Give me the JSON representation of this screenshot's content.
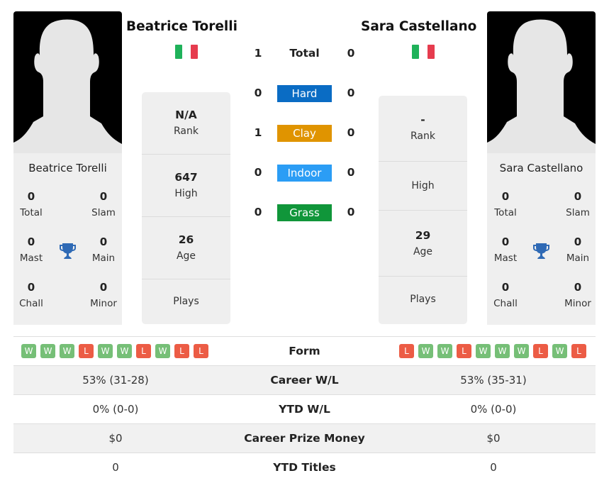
{
  "players": [
    {
      "name": "Beatrice Torelli",
      "country_flag": "italy-flag-icon",
      "titles": {
        "total": {
          "value": "0",
          "label": "Total"
        },
        "slam": {
          "value": "0",
          "label": "Slam"
        },
        "mast": {
          "value": "0",
          "label": "Mast"
        },
        "main": {
          "value": "0",
          "label": "Main"
        },
        "chall": {
          "value": "0",
          "label": "Chall"
        },
        "minor": {
          "value": "0",
          "label": "Minor"
        }
      },
      "rank": {
        "value": "N/A",
        "label": "Rank"
      },
      "high": {
        "value": "647",
        "label": "High"
      },
      "age": {
        "value": "26",
        "label": "Age"
      },
      "plays": {
        "value": "",
        "label": "Plays"
      },
      "form": [
        "W",
        "W",
        "W",
        "L",
        "W",
        "W",
        "L",
        "W",
        "L",
        "L"
      ],
      "career_wl": "53% (31-28)",
      "ytd_wl": "0% (0-0)",
      "prize_money": "$0",
      "ytd_titles": "0"
    },
    {
      "name": "Sara Castellano",
      "country_flag": "italy-flag-icon",
      "titles": {
        "total": {
          "value": "0",
          "label": "Total"
        },
        "slam": {
          "value": "0",
          "label": "Slam"
        },
        "mast": {
          "value": "0",
          "label": "Mast"
        },
        "main": {
          "value": "0",
          "label": "Main"
        },
        "chall": {
          "value": "0",
          "label": "Chall"
        },
        "minor": {
          "value": "0",
          "label": "Minor"
        }
      },
      "rank": {
        "value": "-",
        "label": "Rank"
      },
      "high": {
        "value": "",
        "label": "High"
      },
      "age": {
        "value": "29",
        "label": "Age"
      },
      "plays": {
        "value": "",
        "label": "Plays"
      },
      "form": [
        "L",
        "W",
        "W",
        "L",
        "W",
        "W",
        "W",
        "L",
        "W",
        "L"
      ],
      "career_wl": "53% (35-31)",
      "ytd_wl": "0% (0-0)",
      "prize_money": "$0",
      "ytd_titles": "0"
    }
  ],
  "h2h": [
    {
      "label": "Total",
      "left": "1",
      "right": "0",
      "color": ""
    },
    {
      "label": "Hard",
      "left": "0",
      "right": "0",
      "color": "#0a6cc4"
    },
    {
      "label": "Clay",
      "left": "1",
      "right": "0",
      "color": "#e09400"
    },
    {
      "label": "Indoor",
      "left": "0",
      "right": "0",
      "color": "#2b9df5"
    },
    {
      "label": "Grass",
      "left": "0",
      "right": "0",
      "color": "#10963a"
    }
  ],
  "table": {
    "form_label": "Form",
    "career_wl_label": "Career W/L",
    "ytd_wl_label": "YTD W/L",
    "prize_money_label": "Career Prize Money",
    "ytd_titles_label": "YTD Titles"
  }
}
